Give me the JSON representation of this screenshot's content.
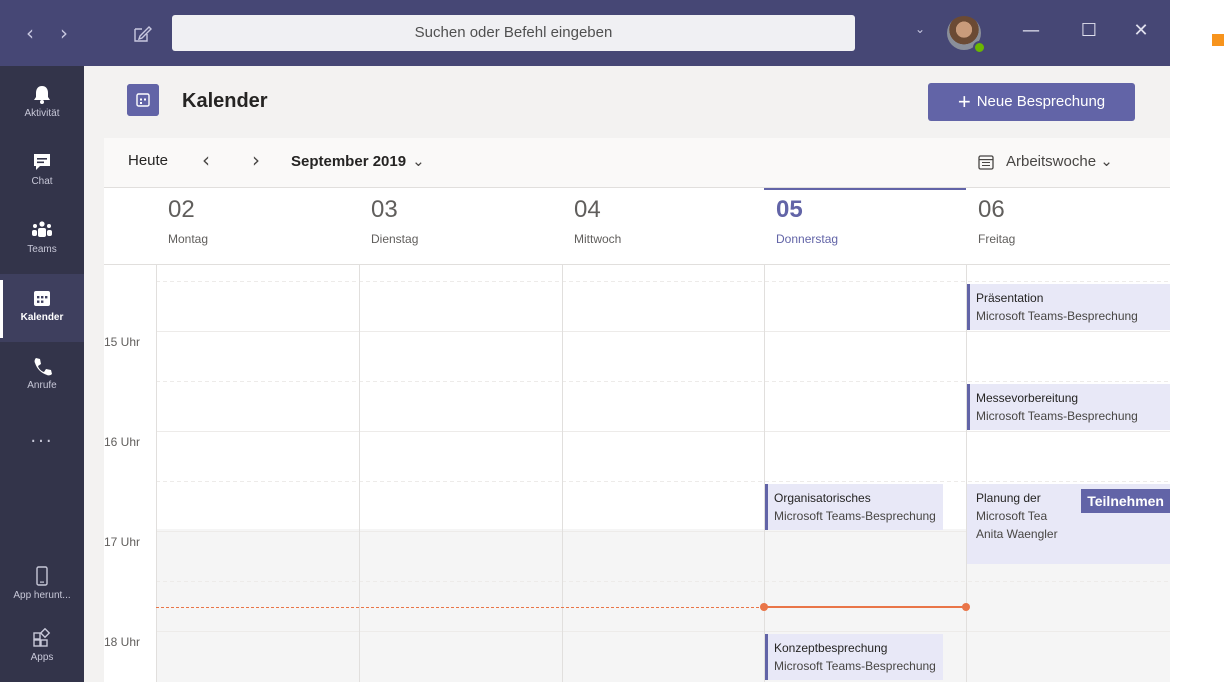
{
  "titlebar": {
    "search_placeholder": "Suchen oder Befehl eingeben",
    "back_icon": "chevron-left-icon",
    "forward_icon": "chevron-right-icon",
    "compose_icon": "compose-icon",
    "minimize_glyph": "—",
    "maximize_glyph": "☐",
    "close_glyph": "✕"
  },
  "rail": {
    "items": [
      {
        "label": "Aktivität",
        "icon": "bell-icon"
      },
      {
        "label": "Chat",
        "icon": "chat-icon"
      },
      {
        "label": "Teams",
        "icon": "teams-icon"
      },
      {
        "label": "Kalender",
        "icon": "calendar-icon",
        "active": true
      },
      {
        "label": "Anrufe",
        "icon": "phone-icon"
      }
    ],
    "more": "...",
    "bottom_items": [
      {
        "label": "App herunt...",
        "icon": "mobile-device-icon"
      },
      {
        "label": "Apps",
        "icon": "apps-icon"
      }
    ]
  },
  "header": {
    "title": "Kalender",
    "new_meeting_label": "Neue Besprechung",
    "new_meeting_plus": "+"
  },
  "toolbar": {
    "today_label": "Heute",
    "month_label": "September 2019",
    "view_label": "Arbeitswoche"
  },
  "days": [
    {
      "num": "02",
      "name": "Montag"
    },
    {
      "num": "03",
      "name": "Dienstag"
    },
    {
      "num": "04",
      "name": "Mittwoch"
    },
    {
      "num": "05",
      "name": "Donnerstag",
      "today": true
    },
    {
      "num": "06",
      "name": "Freitag"
    }
  ],
  "times": [
    "15 Uhr",
    "16 Uhr",
    "17 Uhr",
    "18 Uhr"
  ],
  "events": [
    {
      "title": "Präsentation",
      "subtitle": "Microsoft Teams-Besprechung",
      "day": "06"
    },
    {
      "title": "Messevorbereitung",
      "subtitle": "Microsoft Teams-Besprechung",
      "day": "06"
    },
    {
      "title": "Organisatorisches",
      "subtitle": "Microsoft Teams-Besprechung",
      "day": "05"
    },
    {
      "title": "Planung der",
      "subtitle": "Microsoft Tea",
      "organizer": "Anita Waengler",
      "join_label": "Teilnehmen",
      "day": "06"
    },
    {
      "title": "Konzeptbesprechung",
      "subtitle": "Microsoft Teams-Besprechung",
      "day": "05"
    }
  ],
  "colors": {
    "brand": "#6264a7",
    "titlebar": "#464775",
    "rail": "#33344a",
    "event_bg": "#e8e8f7",
    "now_line": "#e97548",
    "presence": "#6bb700"
  }
}
